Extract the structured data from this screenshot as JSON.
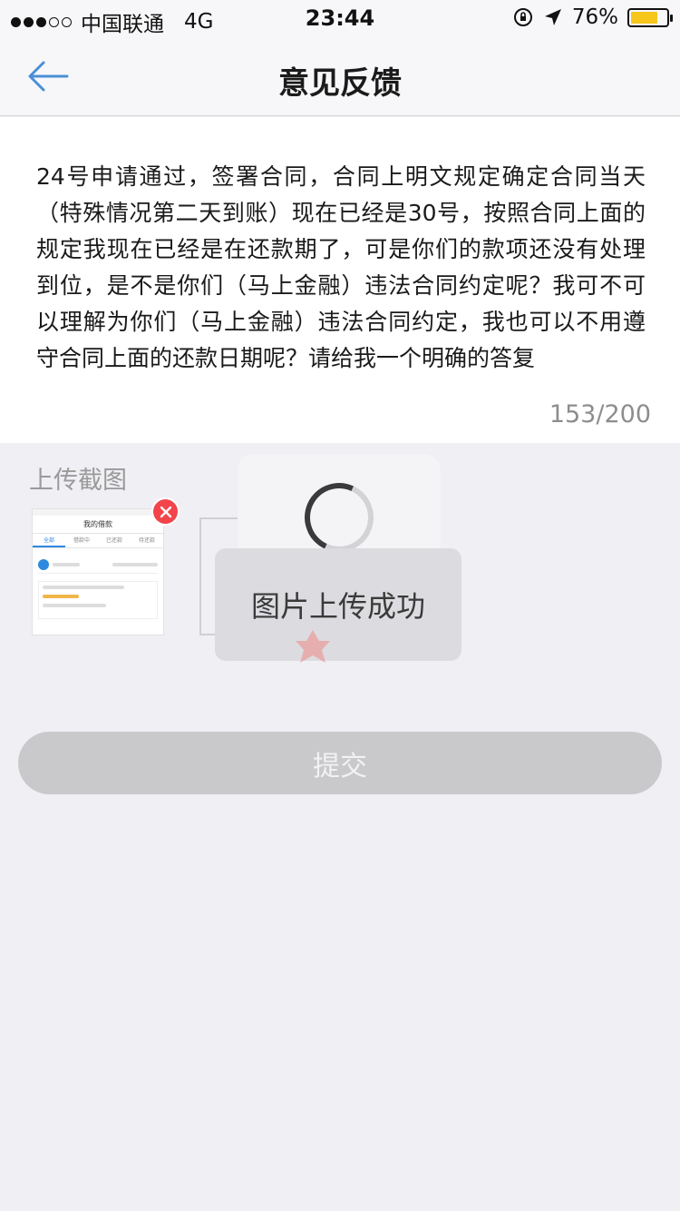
{
  "status_bar": {
    "carrier": "中国联通",
    "network": "4G",
    "time": "23:44",
    "battery_percent": "76%",
    "battery_level": 0.76,
    "icons": [
      "signal-dots-icon",
      "orientation-lock-icon",
      "location-arrow-icon",
      "battery-icon"
    ]
  },
  "nav": {
    "title": "意见反馈",
    "back_icon": "back-arrow-icon"
  },
  "feedback": {
    "text": "24号申请通过，签署合同，合同上明文规定确定合同当天（特殊情况第二天到账）现在已经是30号，按照合同上面的规定我现在已经是在还款期了，可是你们的款项还没有处理到位，是不是你们（马上金融）违法合同约定呢？我可不可以理解为你们（马上金融）违法合同约定，我也可以不用遵守合同上面的还款日期呢？请给我一个明确的答复",
    "char_count": "153/200"
  },
  "upload": {
    "label": "上传截图",
    "thumbnail": {
      "title": "我的借款",
      "tabs": [
        "全部",
        "借款中",
        "已还款",
        "待还款"
      ]
    },
    "delete_icon": "close-icon"
  },
  "toast": {
    "text": "图片上传成功"
  },
  "submit": {
    "label": "提交"
  },
  "colors": {
    "accent_blue": "#4a8fd6",
    "delete_red": "#f3434b",
    "battery_yellow": "#f6c61b",
    "button_disabled": "#c9c9cc"
  }
}
